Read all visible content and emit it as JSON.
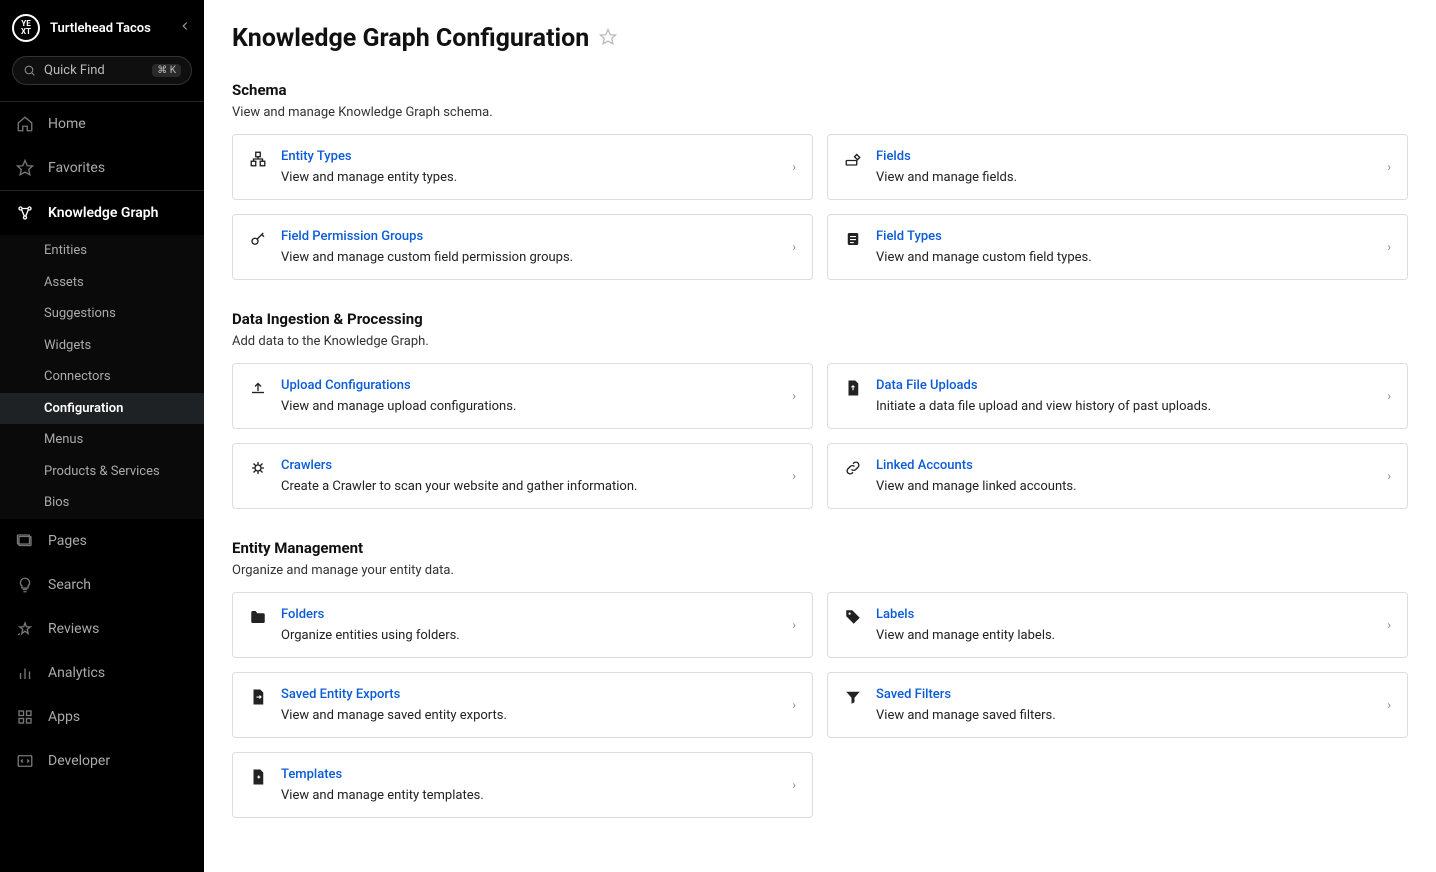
{
  "brand": "Turtlehead Tacos",
  "quickfind": {
    "placeholder": "Quick Find",
    "shortcut": "⌘ K"
  },
  "nav": {
    "home": "Home",
    "favorites": "Favorites",
    "knowledge_graph": "Knowledge Graph",
    "pages": "Pages",
    "search": "Search",
    "reviews": "Reviews",
    "analytics": "Analytics",
    "apps": "Apps",
    "developer": "Developer"
  },
  "subnav": {
    "entities": "Entities",
    "assets": "Assets",
    "suggestions": "Suggestions",
    "widgets": "Widgets",
    "connectors": "Connectors",
    "configuration": "Configuration",
    "menus": "Menus",
    "products_services": "Products & Services",
    "bios": "Bios"
  },
  "page": {
    "title": "Knowledge Graph Configuration"
  },
  "sections": {
    "schema": {
      "title": "Schema",
      "desc": "View and manage Knowledge Graph schema.",
      "cards": {
        "entity_types": {
          "title": "Entity Types",
          "desc": "View and manage entity types."
        },
        "fields": {
          "title": "Fields",
          "desc": "View and manage fields."
        },
        "field_permission_groups": {
          "title": "Field Permission Groups",
          "desc": "View and manage custom field permission groups."
        },
        "field_types": {
          "title": "Field Types",
          "desc": "View and manage custom field types."
        }
      }
    },
    "ingestion": {
      "title": "Data Ingestion & Processing",
      "desc": "Add data to the Knowledge Graph.",
      "cards": {
        "upload_configurations": {
          "title": "Upload Configurations",
          "desc": "View and manage upload configurations."
        },
        "data_file_uploads": {
          "title": "Data File Uploads",
          "desc": "Initiate a data file upload and view history of past uploads."
        },
        "crawlers": {
          "title": "Crawlers",
          "desc": "Create a Crawler to scan your website and gather information."
        },
        "linked_accounts": {
          "title": "Linked Accounts",
          "desc": "View and manage linked accounts."
        }
      }
    },
    "entity_mgmt": {
      "title": "Entity Management",
      "desc": "Organize and manage your entity data.",
      "cards": {
        "folders": {
          "title": "Folders",
          "desc": "Organize entities using folders."
        },
        "labels": {
          "title": "Labels",
          "desc": "View and manage entity labels."
        },
        "saved_entity_exports": {
          "title": "Saved Entity Exports",
          "desc": "View and manage saved entity exports."
        },
        "saved_filters": {
          "title": "Saved Filters",
          "desc": "View and manage saved filters."
        },
        "templates": {
          "title": "Templates",
          "desc": "View and manage entity templates."
        }
      }
    }
  }
}
